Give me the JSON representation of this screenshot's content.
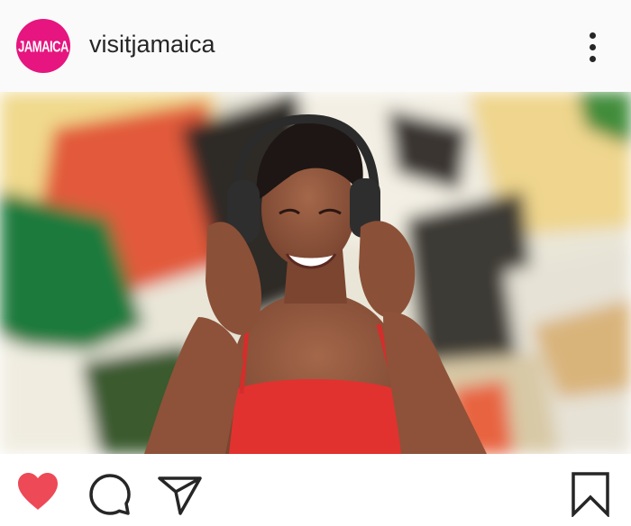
{
  "post": {
    "avatar_text": "JAMAICA",
    "username": "visitjamaica",
    "liked": true
  },
  "icons": {
    "avatar": "jamaica-logo-icon",
    "more": "more-vertical-icon",
    "like": "heart-icon",
    "comment": "comment-icon",
    "share": "send-icon",
    "save": "bookmark-icon"
  },
  "colors": {
    "brand": "#e6157f",
    "like": "#ed4956",
    "icon": "#262626"
  }
}
